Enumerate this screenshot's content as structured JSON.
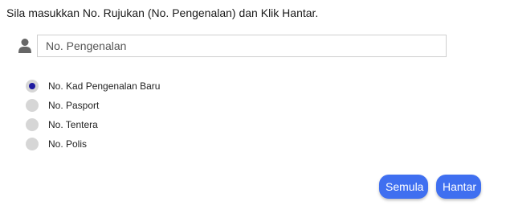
{
  "instruction": "Sila masukkan No. Rujukan (No. Pengenalan) dan Klik Hantar.",
  "id_field": {
    "icon": "user-icon",
    "placeholder": "No. Pengenalan",
    "value": ""
  },
  "id_types": [
    {
      "label": "No. Kad Pengenalan Baru",
      "selected": true
    },
    {
      "label": "No. Pasport",
      "selected": false
    },
    {
      "label": "No. Tentera",
      "selected": false
    },
    {
      "label": "No. Polis",
      "selected": false
    }
  ],
  "buttons": {
    "reset_label": "Semula",
    "submit_label": "Hantar"
  },
  "colors": {
    "button": "#3f6ff0",
    "radio_selected": "#1e1aa0",
    "radio_unselected": "#d6d6d6"
  }
}
